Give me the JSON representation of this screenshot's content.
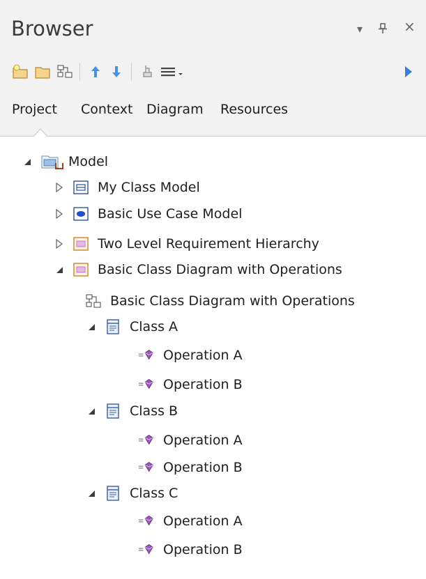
{
  "header": {
    "title": "Browser",
    "dropdown_glyph": "▾",
    "pin_glyph": "ᵖ",
    "close_glyph": "×"
  },
  "toolbar": {
    "tools": [
      "new-package-icon",
      "new-folder-icon",
      "new-diagram-icon",
      "move-up-icon",
      "move-down-icon",
      "locate-icon",
      "menu-icon",
      "run-icon"
    ]
  },
  "tabs": [
    "Project",
    "Context",
    "Diagram",
    "Resources"
  ],
  "active_tab": "Project",
  "tree": [
    {
      "label": "Model",
      "level": 0,
      "expander": "expanded",
      "icon": "model-root-icon"
    },
    {
      "label": "My Class Model",
      "level": 1,
      "expander": "collapsed",
      "icon": "class-package-icon"
    },
    {
      "label": "Basic Use Case Model",
      "level": 1,
      "expander": "collapsed",
      "icon": "usecase-package-icon"
    },
    {
      "label": "Two Level Requirement Hierarchy",
      "level": 1,
      "expander": "collapsed",
      "icon": "requirement-package-icon"
    },
    {
      "label": "Basic Class Diagram with Operations",
      "level": 1,
      "expander": "expanded",
      "icon": "requirement-package-icon"
    },
    {
      "label": "Basic Class Diagram with Operations",
      "level": 2,
      "expander": "none",
      "icon": "class-diagram-icon"
    },
    {
      "label": "Class A",
      "level": 2,
      "expander": "expanded",
      "icon": "class-icon"
    },
    {
      "label": "Operation A",
      "level": 3,
      "expander": "none",
      "icon": "operation-icon"
    },
    {
      "label": "Operation B",
      "level": 3,
      "expander": "none",
      "icon": "operation-icon"
    },
    {
      "label": "Class B",
      "level": 2,
      "expander": "expanded",
      "icon": "class-icon"
    },
    {
      "label": "Operation A",
      "level": 3,
      "expander": "none",
      "icon": "operation-icon"
    },
    {
      "label": "Operation B",
      "level": 3,
      "expander": "none",
      "icon": "operation-icon"
    },
    {
      "label": "Class C",
      "level": 2,
      "expander": "expanded",
      "icon": "class-icon"
    },
    {
      "label": "Operation A",
      "level": 3,
      "expander": "none",
      "icon": "operation-icon"
    },
    {
      "label": "Operation B",
      "level": 3,
      "expander": "none",
      "icon": "operation-icon"
    }
  ],
  "colors": {
    "panel_bg": "#f2f2f2",
    "tree_bg": "#ffffff",
    "arrow_blue": "#4a90e2",
    "run_blue": "#3d7fd6",
    "operation_purple": "#9b59b6",
    "requirement_pink": "#e7b6e7"
  }
}
